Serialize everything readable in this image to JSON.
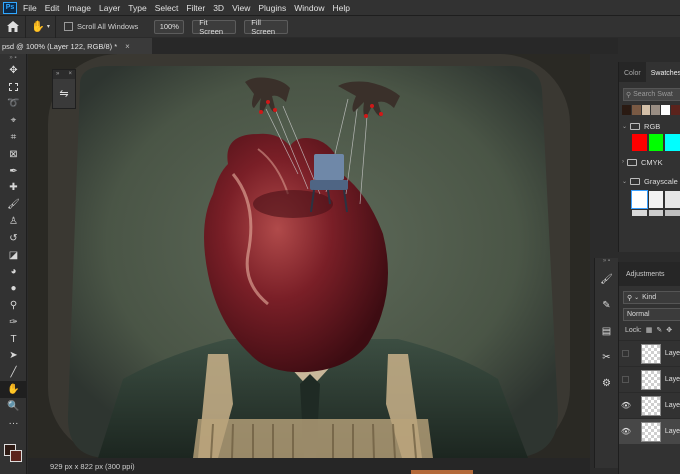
{
  "menu": {
    "logo": "Ps",
    "items": [
      "File",
      "Edit",
      "Image",
      "Layer",
      "Type",
      "Select",
      "Filter",
      "3D",
      "View",
      "Plugins",
      "Window",
      "Help"
    ]
  },
  "options": {
    "scroll_all_label": "Scroll All Windows",
    "zoom_label": "100%",
    "fit_screen_label": "Fit Screen",
    "fill_screen_label": "Fill Screen"
  },
  "document": {
    "tab_title": "psd @ 100% (Layer 122, RGB/8) *",
    "status_text": "929 px x 822 px (300 ppi)"
  },
  "swatches_panel": {
    "tab_color": "Color",
    "tab_swatches": "Swatches",
    "search_placeholder": "Search Swat",
    "recent_colors": [
      "#2a1a12",
      "#7a5a44",
      "#d4c0a8",
      "#9a8e84",
      "#ffffff",
      "#5b231c"
    ],
    "group_rgb": "RGB",
    "rgb_colors": [
      "#ff0000",
      "#00ff00",
      "#00ffff"
    ],
    "group_cmyk": "CMYK",
    "group_grayscale": "Grayscale",
    "gray_colors": [
      "#ffffff",
      "#f2f2f2",
      "#e6e6e6"
    ]
  },
  "layers_panel": {
    "tab_adjustments": "Adjustments",
    "kind_label": "Kind",
    "blend_mode": "Normal",
    "lock_label": "Lock:",
    "layers": [
      {
        "name": "Laye",
        "visible": false
      },
      {
        "name": "Laye",
        "visible": false
      },
      {
        "name": "Laye",
        "visible": true
      },
      {
        "name": "Laye",
        "visible": true
      }
    ]
  }
}
